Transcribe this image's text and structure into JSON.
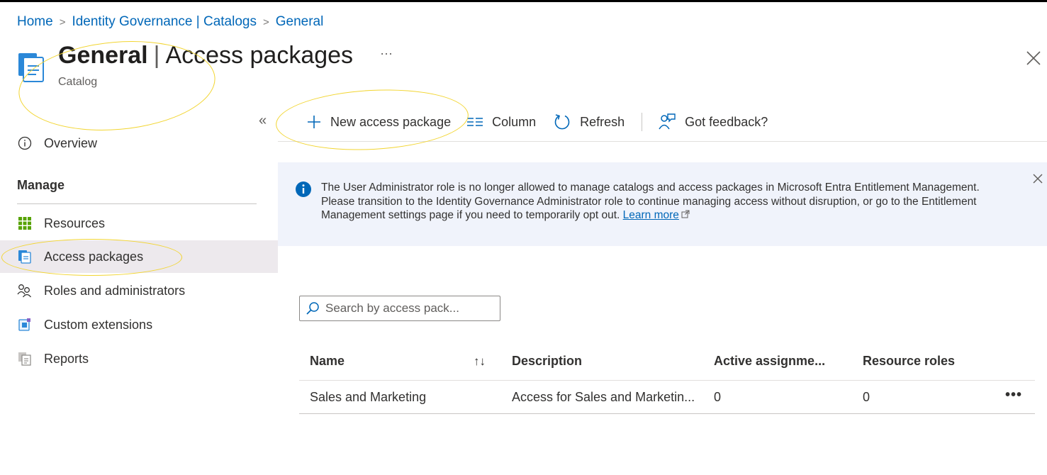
{
  "breadcrumb": [
    "Home",
    "Identity Governance | Catalogs",
    "General"
  ],
  "title": {
    "name": "General",
    "section": "Access packages",
    "more": "···",
    "subtitle": "Catalog"
  },
  "sidebar": {
    "collapse_glyph": "«",
    "overview": "Overview",
    "manage_header": "Manage",
    "items": [
      {
        "label": "Resources",
        "icon": "grid-icon"
      },
      {
        "label": "Access packages",
        "icon": "access-package-icon",
        "selected": true
      },
      {
        "label": "Roles and administrators",
        "icon": "people-icon"
      },
      {
        "label": "Custom extensions",
        "icon": "extension-icon"
      },
      {
        "label": "Reports",
        "icon": "report-icon"
      }
    ]
  },
  "toolbar": {
    "new_label": "New access package",
    "column_label": "Column",
    "refresh_label": "Refresh",
    "feedback_label": "Got feedback?"
  },
  "banner": {
    "text": "The User Administrator role is no longer allowed to manage catalogs and access packages in Microsoft Entra Entitlement Management. Please transition to the Identity Governance Administrator role to continue managing access without disruption, or go to the Entitlement Management settings page if you need to temporarily opt out.",
    "link": "Learn more"
  },
  "search": {
    "placeholder": "Search by access pack..."
  },
  "table": {
    "headers": [
      "Name",
      "Description",
      "Active assignme...",
      "Resource roles"
    ],
    "sort_glyph": "↑↓",
    "rows": [
      {
        "name": "Sales and Marketing",
        "description": "Access for Sales and Marketin...",
        "active": "0",
        "roles": "0",
        "more": "•••"
      }
    ]
  },
  "colors": {
    "accent": "#0067b8",
    "annotation": "#f2d531",
    "banner_bg": "#f0f3fb",
    "selected_bg": "#ede9ed"
  }
}
